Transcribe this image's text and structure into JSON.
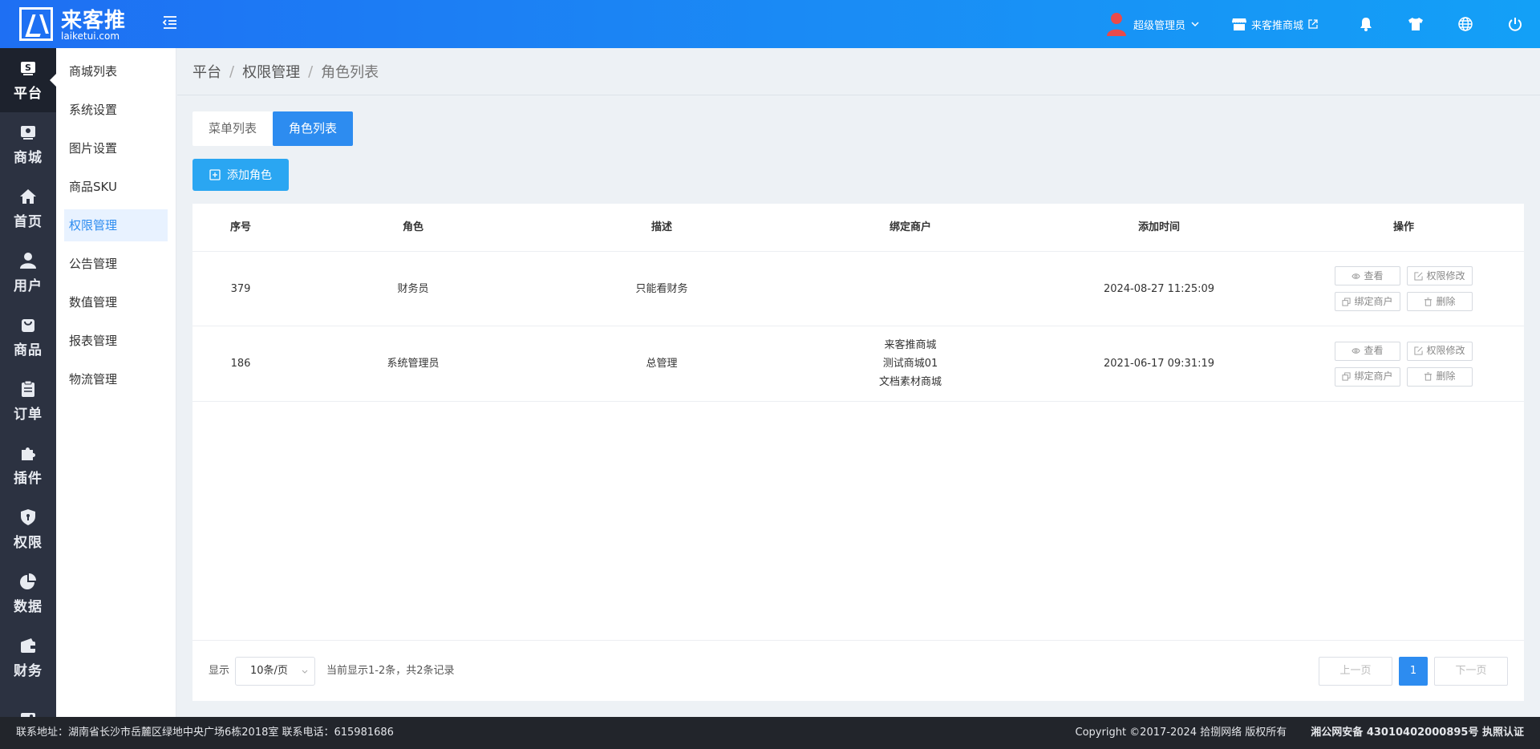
{
  "header": {
    "logo_title": "来客推",
    "logo_domain": "laiketui.com",
    "user_name": "超级管理员",
    "shop_link": "来客推商城",
    "icons": [
      "menu-fold-icon",
      "bell-icon",
      "tshirt-icon",
      "globe-icon",
      "power-icon"
    ]
  },
  "sidebar": {
    "items": [
      {
        "label": "平台",
        "icon": "platform-icon",
        "active": true
      },
      {
        "label": "商城",
        "icon": "mall-icon"
      },
      {
        "label": "首页",
        "icon": "home-icon"
      },
      {
        "label": "用户",
        "icon": "user-icon"
      },
      {
        "label": "商品",
        "icon": "bag-icon"
      },
      {
        "label": "订单",
        "icon": "clipboard-icon"
      },
      {
        "label": "插件",
        "icon": "puzzle-icon"
      },
      {
        "label": "权限",
        "icon": "shield-icon"
      },
      {
        "label": "数据",
        "icon": "pie-chart-icon"
      },
      {
        "label": "财务",
        "icon": "wallet-icon"
      },
      {
        "label": "",
        "icon": "image-icon"
      }
    ]
  },
  "submenu": {
    "items": [
      {
        "label": "商城列表"
      },
      {
        "label": "系统设置"
      },
      {
        "label": "图片设置"
      },
      {
        "label": "商品SKU"
      },
      {
        "label": "权限管理",
        "active": true
      },
      {
        "label": "公告管理"
      },
      {
        "label": "数值管理"
      },
      {
        "label": "报表管理"
      },
      {
        "label": "物流管理"
      }
    ]
  },
  "breadcrumb": [
    "平台",
    "权限管理",
    "角色列表"
  ],
  "tabs": [
    {
      "label": "菜单列表"
    },
    {
      "label": "角色列表",
      "active": true
    }
  ],
  "add_button": "添加角色",
  "table": {
    "columns": [
      "序号",
      "角色",
      "描述",
      "绑定商户",
      "添加时间",
      "操作"
    ],
    "rows": [
      {
        "id": "379",
        "role": "财务员",
        "desc": "只能看财务",
        "merchants": [],
        "time": "2024-08-27 11:25:09"
      },
      {
        "id": "186",
        "role": "系统管理员",
        "desc": "总管理",
        "merchants": [
          "来客推商城",
          "测试商城01",
          "文档素材商城"
        ],
        "time": "2021-06-17 09:31:19"
      }
    ],
    "actions": {
      "view": "查看",
      "edit": "权限修改",
      "bind": "绑定商户",
      "delete": "删除"
    }
  },
  "pagination": {
    "show_label": "显示",
    "page_size": "10条/页",
    "info": "当前显示1-2条，共2条记录",
    "prev": "上一页",
    "current": "1",
    "next": "下一页"
  },
  "footer": {
    "address": "联系地址：湖南省长沙市岳麓区绿地中央广场6栋2018室 联系电话：615981686",
    "copyright": "Copyright ©2017-2024 拾捌网络 版权所有",
    "icp": "湘公网安备 43010402000895号 执照认证"
  },
  "colors": {
    "accent": "#2d8cf0",
    "sidebar": "#2c3241",
    "header_start": "#1e6ff3",
    "header_end": "#13a0f7"
  }
}
